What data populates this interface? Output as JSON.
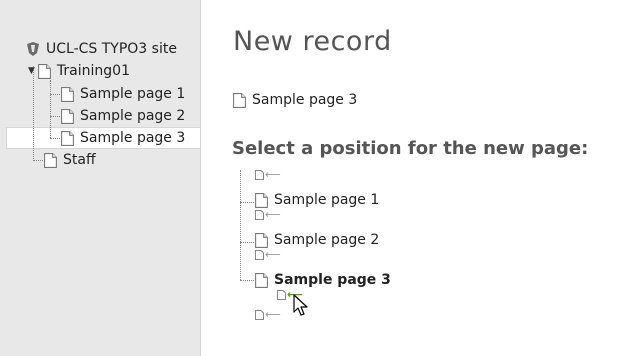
{
  "tree": {
    "site_label": "UCL-CS TYPO3 site",
    "nodes": [
      {
        "label": "Training01"
      },
      {
        "label": "Sample page 1"
      },
      {
        "label": "Sample page 2"
      },
      {
        "label": "Sample page 3"
      },
      {
        "label": "Staff"
      }
    ],
    "selected": "Sample page 3"
  },
  "main": {
    "title": "New record",
    "current_page": "Sample page 3",
    "position_heading": "Select a position for the new page:",
    "position_tree": [
      {
        "label": "Sample page 1",
        "bold": false
      },
      {
        "label": "Sample page 2",
        "bold": false
      },
      {
        "label": "Sample page 3",
        "bold": true
      }
    ]
  },
  "icons": {
    "site": "typo3-logo-icon",
    "page": "page-icon",
    "insert": "insert-position-icon",
    "cursor": "mouse-pointer-icon"
  },
  "colors": {
    "tree_background": "#e8e8e8",
    "active_insert_arrow": "#5a9a00",
    "heading_text": "#555555"
  }
}
